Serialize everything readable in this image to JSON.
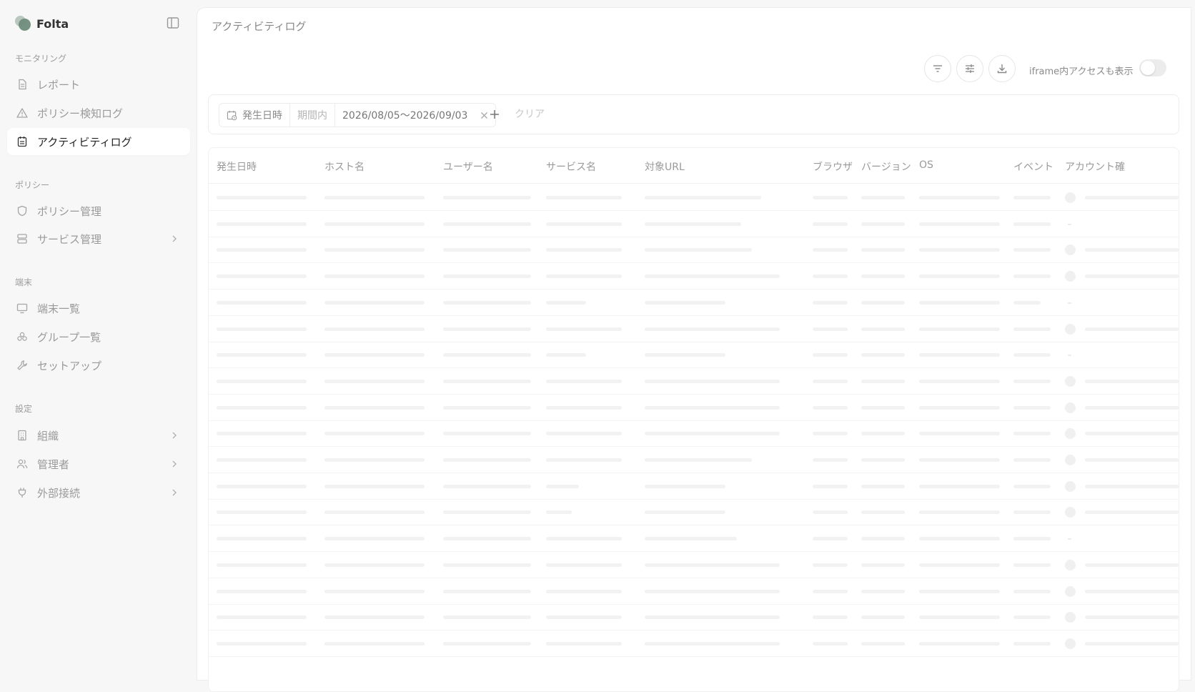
{
  "app": {
    "name": "Folta"
  },
  "sidebar": {
    "sections": [
      {
        "title": "モニタリング",
        "items": [
          {
            "label": "レポート",
            "icon": "document-icon"
          },
          {
            "label": "ポリシー検知ログ",
            "icon": "warning-icon"
          },
          {
            "label": "アクティビティログ",
            "icon": "calendar-list-icon",
            "active": true
          }
        ]
      },
      {
        "title": "ポリシー",
        "items": [
          {
            "label": "ポリシー管理",
            "icon": "shield-icon"
          },
          {
            "label": "サービス管理",
            "icon": "server-icon",
            "has_submenu": true
          }
        ]
      },
      {
        "title": "端末",
        "items": [
          {
            "label": "端末一覧",
            "icon": "monitor-icon"
          },
          {
            "label": "グループ一覧",
            "icon": "group-icon"
          },
          {
            "label": "セットアップ",
            "icon": "wrench-icon"
          }
        ]
      },
      {
        "title": "設定",
        "items": [
          {
            "label": "組織",
            "icon": "building-icon",
            "has_submenu": true
          },
          {
            "label": "管理者",
            "icon": "users-icon",
            "has_submenu": true
          },
          {
            "label": "外部接続",
            "icon": "plug-icon",
            "has_submenu": true
          }
        ]
      }
    ]
  },
  "page": {
    "title": "アクティビティログ",
    "toolbar": {
      "buttons": [
        "filter-icon",
        "sliders-icon",
        "download-icon"
      ],
      "toggle_label": "iframe内アクセスも表示",
      "toggle_on": false
    },
    "filter": {
      "field": "発生日時",
      "operator": "期間内",
      "value": "2026/08/05〜2026/09/03",
      "clear_label": "クリア"
    },
    "table": {
      "columns": [
        "発生日時",
        "ホスト名",
        "ユーザー名",
        "サービス名",
        "対象URL",
        "ブラウザ",
        "バージョン",
        "OS",
        "イベント",
        "アカウント確"
      ],
      "loading": true
    }
  },
  "colors": {
    "background": "#f7f7f7",
    "panel": "#ffffff",
    "active_item": "#ffffff",
    "brand_green": "#6f8c7b"
  }
}
